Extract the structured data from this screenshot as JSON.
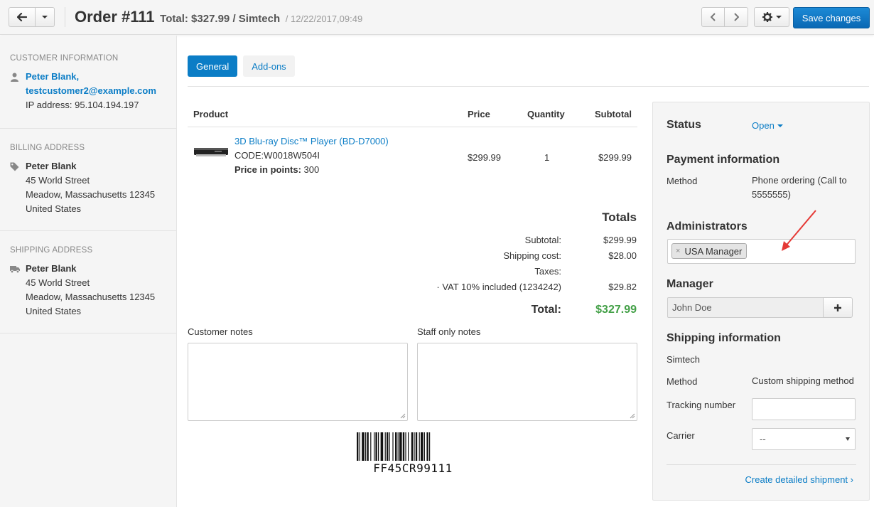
{
  "header": {
    "title": "Order #111",
    "total": "Total: $327.99 / Simtech",
    "date": "/ 12/22/2017,09:49",
    "save_label": "Save changes"
  },
  "sidebar": {
    "customer": {
      "heading": "Customer information",
      "name": "Peter Blank,",
      "email": "testcustomer2@example.com",
      "ip": "IP address: 95.104.194.197"
    },
    "billing": {
      "heading": "Billing address",
      "name": "Peter Blank",
      "street": "45 World Street",
      "city": "Meadow, Massachusetts 12345",
      "country": "United States"
    },
    "shipping": {
      "heading": "Shipping address",
      "name": "Peter Blank",
      "street": "45 World Street",
      "city": "Meadow, Massachusetts 12345",
      "country": "United States"
    }
  },
  "tabs": [
    {
      "label": "General"
    },
    {
      "label": "Add-ons"
    }
  ],
  "products": {
    "headers": {
      "product": "Product",
      "price": "Price",
      "quantity": "Quantity",
      "subtotal": "Subtotal"
    },
    "rows": [
      {
        "name": "3D Blu-ray Disc™ Player (BD-D7000)",
        "code": "CODE:W0018W504I",
        "points_label": "Price in points:",
        "points_value": "300",
        "price": "$299.99",
        "quantity": "1",
        "subtotal": "$299.99"
      }
    ]
  },
  "totals": {
    "title": "Totals",
    "subtotal_label": "Subtotal:",
    "subtotal": "$299.99",
    "shipping_label": "Shipping cost:",
    "shipping": "$28.00",
    "taxes_label": "Taxes:",
    "vat_label": "· VAT 10% included (1234242)",
    "vat": "$29.82",
    "total_label": "Total:",
    "total": "$327.99"
  },
  "notes": {
    "customer_label": "Customer notes",
    "staff_label": "Staff only notes"
  },
  "barcode": {
    "text": "FF45CR99111"
  },
  "panel": {
    "status_label": "Status",
    "status_value": "Open",
    "payment_heading": "Payment information",
    "method_label": "Method",
    "payment_method_line1": "Phone ordering (Call to",
    "payment_method_line2": "5555555)",
    "admins_heading": "Administrators",
    "admin_tag": "USA Manager",
    "manager_heading": "Manager",
    "manager_value": "John Doe",
    "shipping_heading": "Shipping information",
    "shipping_company": "Simtech",
    "shipping_method_label": "Method",
    "shipping_method": "Custom shipping method",
    "tracking_label": "Tracking number",
    "carrier_label": "Carrier",
    "carrier_value": "--",
    "shipment_link": "Create detailed shipment ›"
  },
  "colors": {
    "primary": "#0b7dc6",
    "total_green": "#43a047",
    "annotation_arrow": "#e53935"
  }
}
